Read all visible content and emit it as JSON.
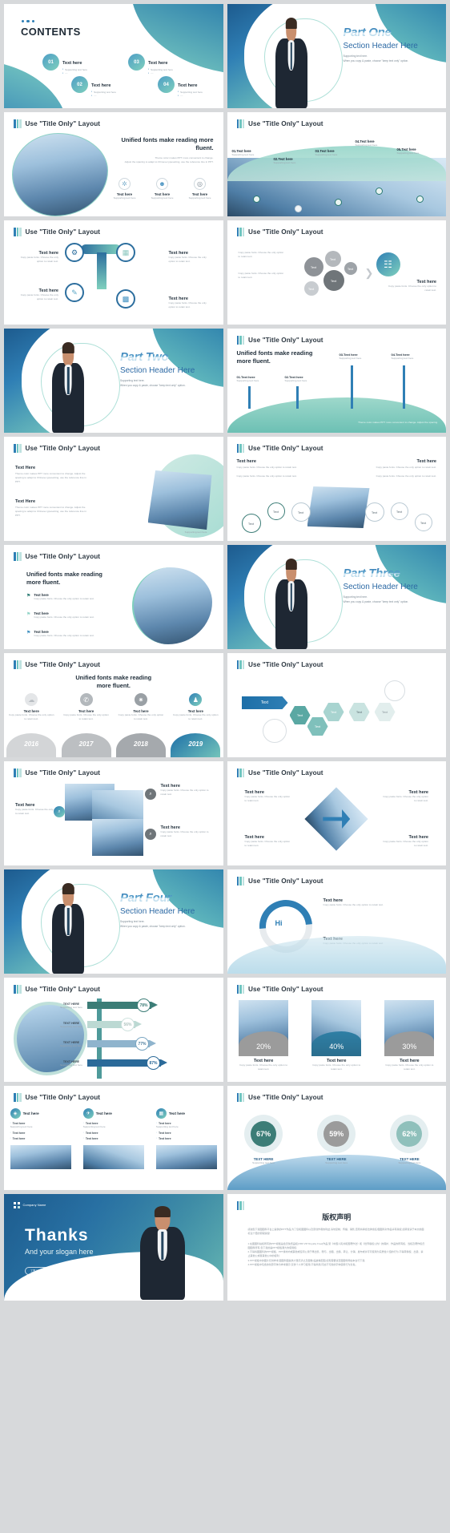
{
  "meta": {
    "title_bar_label": "Use \"Title Only\" Layout"
  },
  "slides": [
    {
      "id": "contents",
      "kind": "contents",
      "title": "CONTENTS",
      "items": [
        {
          "num": "01",
          "label": "Text here",
          "sub": "Supporting text here"
        },
        {
          "num": "02",
          "label": "Text here",
          "sub": "Supporting text here"
        },
        {
          "num": "03",
          "label": "Text here",
          "sub": "Supporting text here"
        },
        {
          "num": "04",
          "label": "Text here",
          "sub": "Supporting text here"
        }
      ]
    },
    {
      "id": "part-one",
      "kind": "section",
      "part": "Part One",
      "header": "Section Header Here",
      "sub1": "Supporting text here.",
      "sub2": "When you copy & paste, choose \"keep text only\" option."
    },
    {
      "id": "icons-three",
      "kind": "title-only",
      "title": "Use \"Title Only\" Layout",
      "heading": "Unified fonts make reading more fluent.",
      "body1": "Theme color makes PPT more convenient to change.",
      "body2": "Adjust the spacing to adapt to Chinese typesetting, use the reference line in PPT.",
      "cards": [
        {
          "label": "Text here",
          "sub": "Supporting text here",
          "icon": "gear-icon"
        },
        {
          "label": "Text here",
          "sub": "Supporting text here",
          "icon": "person-icon"
        },
        {
          "label": "Text here",
          "sub": "Supporting text here",
          "icon": "clock-icon"
        }
      ]
    },
    {
      "id": "five-steps",
      "kind": "title-only",
      "title": "Use \"Title Only\" Layout",
      "steps": [
        {
          "label": "01.Text here",
          "sub": "Supporting text here"
        },
        {
          "label": "02.Text here",
          "sub": "Supporting text here"
        },
        {
          "label": "03.Text here",
          "sub": "Supporting text here"
        },
        {
          "label": "04.Text here",
          "sub": "Supporting text here"
        },
        {
          "label": "05.Text here",
          "sub": "Supporting text here"
        }
      ]
    },
    {
      "id": "four-nodes",
      "kind": "title-only",
      "title": "Use \"Title Only\" Layout",
      "nodes": [
        {
          "label": "Text here",
          "sub": "Copy paste fonts. Choose the only option to retain text."
        },
        {
          "label": "Text here",
          "sub": "Copy paste fonts. Choose the only option to retain text."
        },
        {
          "label": "Text here",
          "sub": "Copy paste fonts. Choose the only option to retain text."
        },
        {
          "label": "Text here",
          "sub": "Copy paste fonts. Choose the only option to retain text."
        }
      ]
    },
    {
      "id": "bubble-cluster",
      "kind": "title-only",
      "title": "Use \"Title Only\" Layout",
      "bubbles": [
        "Text",
        "Text",
        "Text",
        "Text",
        "Text"
      ],
      "right_label": "Text here",
      "right_sub": "Copy paste fonts. Choose the only option to retain text.",
      "left_subs": [
        "Copy paste fonts. Choose the only option to retain text.",
        "Copy paste fonts. Choose the only option to retain text."
      ]
    },
    {
      "id": "part-two",
      "kind": "section",
      "part": "Part Two",
      "header": "Section Header Here",
      "sub1": "Supporting text here.",
      "sub2": "When you copy & paste, choose \"keep text only\" option."
    },
    {
      "id": "four-markers",
      "kind": "title-only",
      "title": "Use \"Title Only\" Layout",
      "heading": "Unified fonts make reading more fluent.",
      "markers": [
        {
          "label": "01.Text here",
          "sub": "Supporting text here"
        },
        {
          "label": "02.Text here",
          "sub": "Supporting text here"
        },
        {
          "label": "03.Text here",
          "sub": "Supporting text here"
        },
        {
          "label": "04.Text here",
          "sub": "Supporting text here"
        }
      ],
      "footer": "Theme color makes PPT more convenient to change. Adjust the spacing."
    },
    {
      "id": "circle-photo",
      "kind": "title-only",
      "title": "Use \"Title Only\" Layout",
      "blocks": [
        {
          "label": "Text Here",
          "sub": "Theme color makes PPT more convenient to change. Adjust the spacing to adapt to Chinese typesetting, use the reference line in PPT."
        },
        {
          "label": "Text Here",
          "sub": "Theme color makes PPT more convenient to change. Adjust the spacing to adapt to Chinese typesetting, use the reference line in PPT."
        }
      ],
      "caption": "Supporting text here"
    },
    {
      "id": "seven-circles",
      "kind": "title-only",
      "title": "Use \"Title Only\" Layout",
      "left_label": "Text here",
      "right_label": "Text here",
      "left_p1": "Copy paste fonts. Choose the only option to retain text.",
      "left_p2": "Copy paste fonts. Choose the only option to retain text.",
      "right_p1": "Copy paste fonts. Choose the only option to retain text.",
      "right_p2": "Copy paste fonts. Choose the only option to retain text.",
      "circles": [
        "Text",
        "Text",
        "Text",
        "Text",
        "Text",
        "Text"
      ]
    },
    {
      "id": "bullets-photo",
      "kind": "title-only",
      "title": "Use \"Title Only\" Layout",
      "heading": "Unified fonts make reading more fluent.",
      "bullets": [
        {
          "label": "Text here",
          "sub": "Copy paste fonts. Choose the only option to retain text."
        },
        {
          "label": "Text here",
          "sub": "Copy paste fonts. Choose the only option to retain text."
        },
        {
          "label": "Text here",
          "sub": "Copy paste fonts. Choose the only option to retain text."
        }
      ]
    },
    {
      "id": "part-three",
      "kind": "section",
      "part": "Part Three",
      "header": "Section Header Here",
      "sub1": "Supporting text here.",
      "sub2": "When you copy & paste, choose \"keep text only\" option."
    },
    {
      "id": "timeline-years",
      "kind": "title-only",
      "title": "Use \"Title Only\" Layout",
      "heading": "Unified fonts make reading more fluent.",
      "columns": [
        {
          "label": "Text here",
          "sub": "Copy paste fonts. Choose the only option to retain text.",
          "year": "2016"
        },
        {
          "label": "Text here",
          "sub": "Copy paste fonts. Choose the only option to retain text.",
          "year": "2017"
        },
        {
          "label": "Text here",
          "sub": "Copy paste fonts. Choose the only option to retain text.",
          "year": "2018"
        },
        {
          "label": "Text here",
          "sub": "Copy paste fonts. Choose the only option to retain text.",
          "year": "2019"
        }
      ]
    },
    {
      "id": "hex-flow",
      "kind": "title-only",
      "title": "Use \"Title Only\" Layout",
      "hexes": [
        "Text",
        "Text",
        "Text",
        "Text",
        "Text",
        "Text"
      ]
    },
    {
      "id": "photo-grid-2",
      "kind": "title-only",
      "title": "Use \"Title Only\" Layout",
      "entries": [
        {
          "label": "Text here",
          "sub": "Copy paste fonts. Choose the only option to retain text."
        },
        {
          "label": "Text here",
          "sub": "Copy paste fonts. Choose the only option to retain text."
        },
        {
          "label": "Text here",
          "sub": "Copy paste fonts. Choose the only option to retain text."
        }
      ]
    },
    {
      "id": "pinwheel",
      "kind": "title-only",
      "title": "Use \"Title Only\" Layout",
      "quads": [
        {
          "label": "Text here",
          "sub": "Copy paste fonts. Choose the only option to retain text."
        },
        {
          "label": "Text here",
          "sub": "Copy paste fonts. Choose the only option to retain text."
        },
        {
          "label": "Text here",
          "sub": "Copy paste fonts. Choose the only option to retain text."
        },
        {
          "label": "Text here",
          "sub": "Copy paste fonts. Choose the only option to retain text."
        }
      ]
    },
    {
      "id": "part-four",
      "kind": "section",
      "part": "Part Four",
      "header": "Section Header Here",
      "sub1": "Supporting text here.",
      "sub2": "When you copy & paste, choose \"keep text only\" option."
    },
    {
      "id": "ring-cycle",
      "kind": "title-only",
      "title": "Use \"Title Only\" Layout",
      "center": "Hi",
      "entries": [
        {
          "label": "Text here",
          "sub": "Copy paste fonts. Choose the only option to retain text."
        },
        {
          "label": "Text here",
          "sub": "Copy paste fonts. Choose the only option to retain text."
        }
      ]
    },
    {
      "id": "bar-percentages",
      "kind": "title-only",
      "title": "Use \"Title Only\" Layout",
      "chart_ref": 0
    },
    {
      "id": "photo-percentages",
      "kind": "title-only",
      "title": "Use \"Title Only\" Layout",
      "chart_ref": 1
    },
    {
      "id": "checklist-photos",
      "kind": "title-only",
      "title": "Use \"Title Only\" Layout",
      "columns": [
        {
          "head": "Text here",
          "items": [
            "Text here",
            "Text here",
            "Text here"
          ],
          "sub": "Supporting text here"
        },
        {
          "head": "Text here",
          "items": [
            "Text here",
            "Text here",
            "Text here"
          ],
          "sub": "Supporting text here"
        },
        {
          "head": "Text here",
          "items": [
            "Text here",
            "Text here",
            "Text here"
          ],
          "sub": "Supporting text here"
        }
      ]
    },
    {
      "id": "donut-percentages",
      "kind": "title-only",
      "title": "Use \"Title Only\" Layout",
      "chart_ref": 2
    },
    {
      "id": "thanks",
      "kind": "thanks",
      "company": "Company Name",
      "title": "Thanks",
      "slogan": "And your slogan here",
      "badge": "工笔人 · 通用性"
    },
    {
      "id": "copyright",
      "kind": "copyright",
      "title": "版权声明",
      "paragraphs": [
        "感谢您下载图图科平台上提供的PPT作品,为了您和图图科以及原创作者的利益,请勿复制、传播、销售,否则将承担法律责任!图图科对作品享有版权,如转载请于本文前面标注十倍的索取版权!",
        "1.在图图科站权所有的PPT模板是会员免费品权(VRF:VIP Royalty Free)作品,受《中国人民共和国著作法》和《世界版权公约》的保护、作品的所有权、当权及著作权归图图科所有,您下载的是PPT模板课大的使用权;",
        "2.不得将图图科的PPT模板、PPT素材内或其他或任何公用于再出售、赠与、出租、出借、转让、分销、发布或许可可使用为实质性介绍的行为,不得转授权、出卖、禁止其他公或者其他公中的权利;",
        "3.PPT模板中的图片仅供参考,图图科图提供大量高清之及图像,临故等配图,如有需要请至图图科网站本台行下载;",
        "4.PPT模板中包含的创意字体为参考展示,仅供个人学习使用,不得商用,同这不可授的字体使用行为负责。"
      ]
    }
  ],
  "chart_data": [
    {
      "type": "bar",
      "title": "Use \"Title Only\" Layout",
      "orientation": "horizontal",
      "categories": [
        "TEXT HERE",
        "TEXT HERE",
        "TEXT HERE",
        "TEXT HERE"
      ],
      "values": [
        78,
        56,
        77,
        87
      ],
      "value_labels": [
        "78%",
        "56%",
        "77%",
        "87%"
      ],
      "sublabels": [
        "Supporting text here",
        "Supporting text here",
        "Supporting text here",
        "Supporting text here"
      ],
      "colors": [
        "#3c7d77",
        "#bcd9d3",
        "#8fb4cd",
        "#2b6a99"
      ],
      "xlabel": "",
      "ylabel": "",
      "xlim": [
        0,
        100
      ],
      "grid": false,
      "legend": "none"
    },
    {
      "type": "bar",
      "title": "Use \"Title Only\" Layout",
      "orientation": "photo-cards",
      "categories": [
        "Text here",
        "Text here",
        "Text here"
      ],
      "values": [
        20,
        40,
        30
      ],
      "value_labels": [
        "20%",
        "40%",
        "30%"
      ],
      "sublabels": [
        "Copy paste fonts. Choose the only option to retain text.",
        "Copy paste fonts. Choose the only option to retain text.",
        "Copy paste fonts. Choose the only option to retain text."
      ],
      "colors": [
        "#9b9b9b",
        "#2f7fa5",
        "#9b9b9b"
      ],
      "xlabel": "",
      "ylabel": "",
      "ylim": [
        0,
        100
      ],
      "grid": false,
      "legend": "none"
    },
    {
      "type": "pie",
      "title": "Use \"Title Only\" Layout",
      "subtype": "donut-gauges",
      "categories": [
        "TEXT HERE",
        "TEXT HERE",
        "TEXT HERE"
      ],
      "values": [
        67,
        59,
        62
      ],
      "value_labels": [
        "67%",
        "59%",
        "62%"
      ],
      "sublabels": [
        "Supporting text here",
        "Supporting text here",
        "Supporting text here"
      ],
      "colors": [
        "#3c7d77",
        "#9b9b9b",
        "#8fc0bb"
      ],
      "legend": "below"
    }
  ]
}
